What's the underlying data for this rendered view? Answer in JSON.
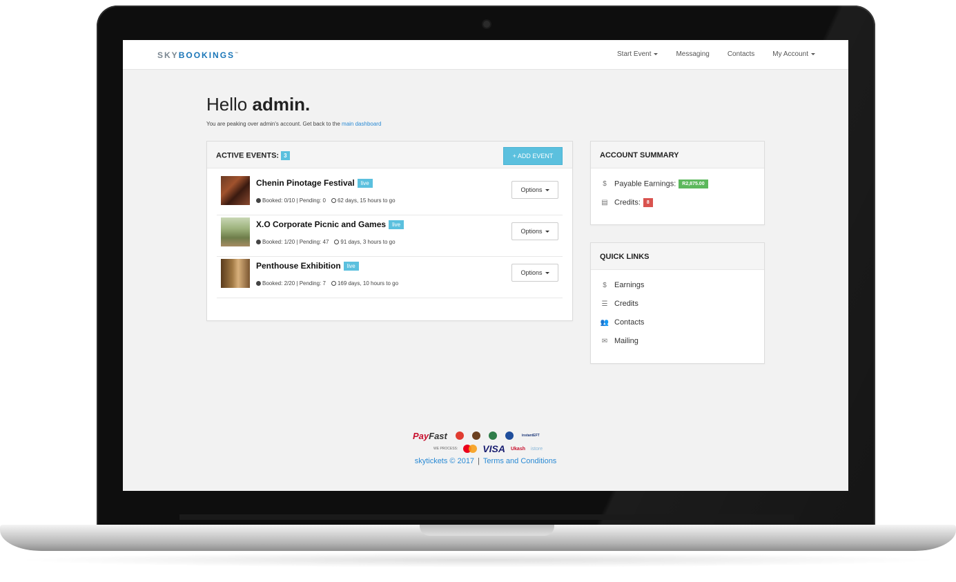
{
  "navbar": {
    "brand_part1": "SKY",
    "brand_part2": "BOOKINGS",
    "brand_tm": "™",
    "links": [
      "Start Event",
      "Messaging",
      "Contacts",
      "My Account"
    ]
  },
  "greeting": {
    "hello": "Hello",
    "user": "admin.",
    "subtitle": "You are peaking over admin's account. Get back to the",
    "link": "main dashboard"
  },
  "active_events": {
    "title": "ACTIVE EVENTS:",
    "count": "3",
    "add_button": "+ ADD EVENT",
    "events": [
      {
        "name": "Chenin Pinotage Festival",
        "status": "live",
        "booked": "Booked: 0/10",
        "pending": "Pending: 0",
        "time": "62 days, 15 hours to go",
        "options": "Options"
      },
      {
        "name": "X.O Corporate Picnic and Games",
        "status": "live",
        "booked": "Booked: 1/20",
        "pending": "Pending: 47",
        "time": "91 days, 3 hours to go",
        "options": "Options"
      },
      {
        "name": "Penthouse Exhibition",
        "status": "live",
        "booked": "Booked: 2/20",
        "pending": "Pending: 7",
        "time": "169 days, 10 hours to go",
        "options": "Options"
      }
    ]
  },
  "account_summary": {
    "title": "ACCOUNT SUMMARY",
    "payable_label": "Payable Earnings:",
    "payable_value": "R2,875.00",
    "credits_label": "Credits:",
    "credits_value": "8"
  },
  "quick_links": {
    "title": "QUICK LINKS",
    "items": [
      "Earnings",
      "Credits",
      "Contacts",
      "Mailing"
    ]
  },
  "footer": {
    "payfast_1": "Pay",
    "payfast_2": "Fast",
    "we_process": "WE PROCESS:",
    "visa": "VISA",
    "ukash": "Ukash",
    "istore": "istore",
    "copyright": "skytickets © 2017",
    "separator": "|",
    "terms": "Terms and Conditions",
    "instant_eft": "instantEFT"
  },
  "colors": {
    "accent": "#5bc0de",
    "link": "#2a8ad4",
    "success": "#5cb85c",
    "danger": "#d9534f"
  }
}
